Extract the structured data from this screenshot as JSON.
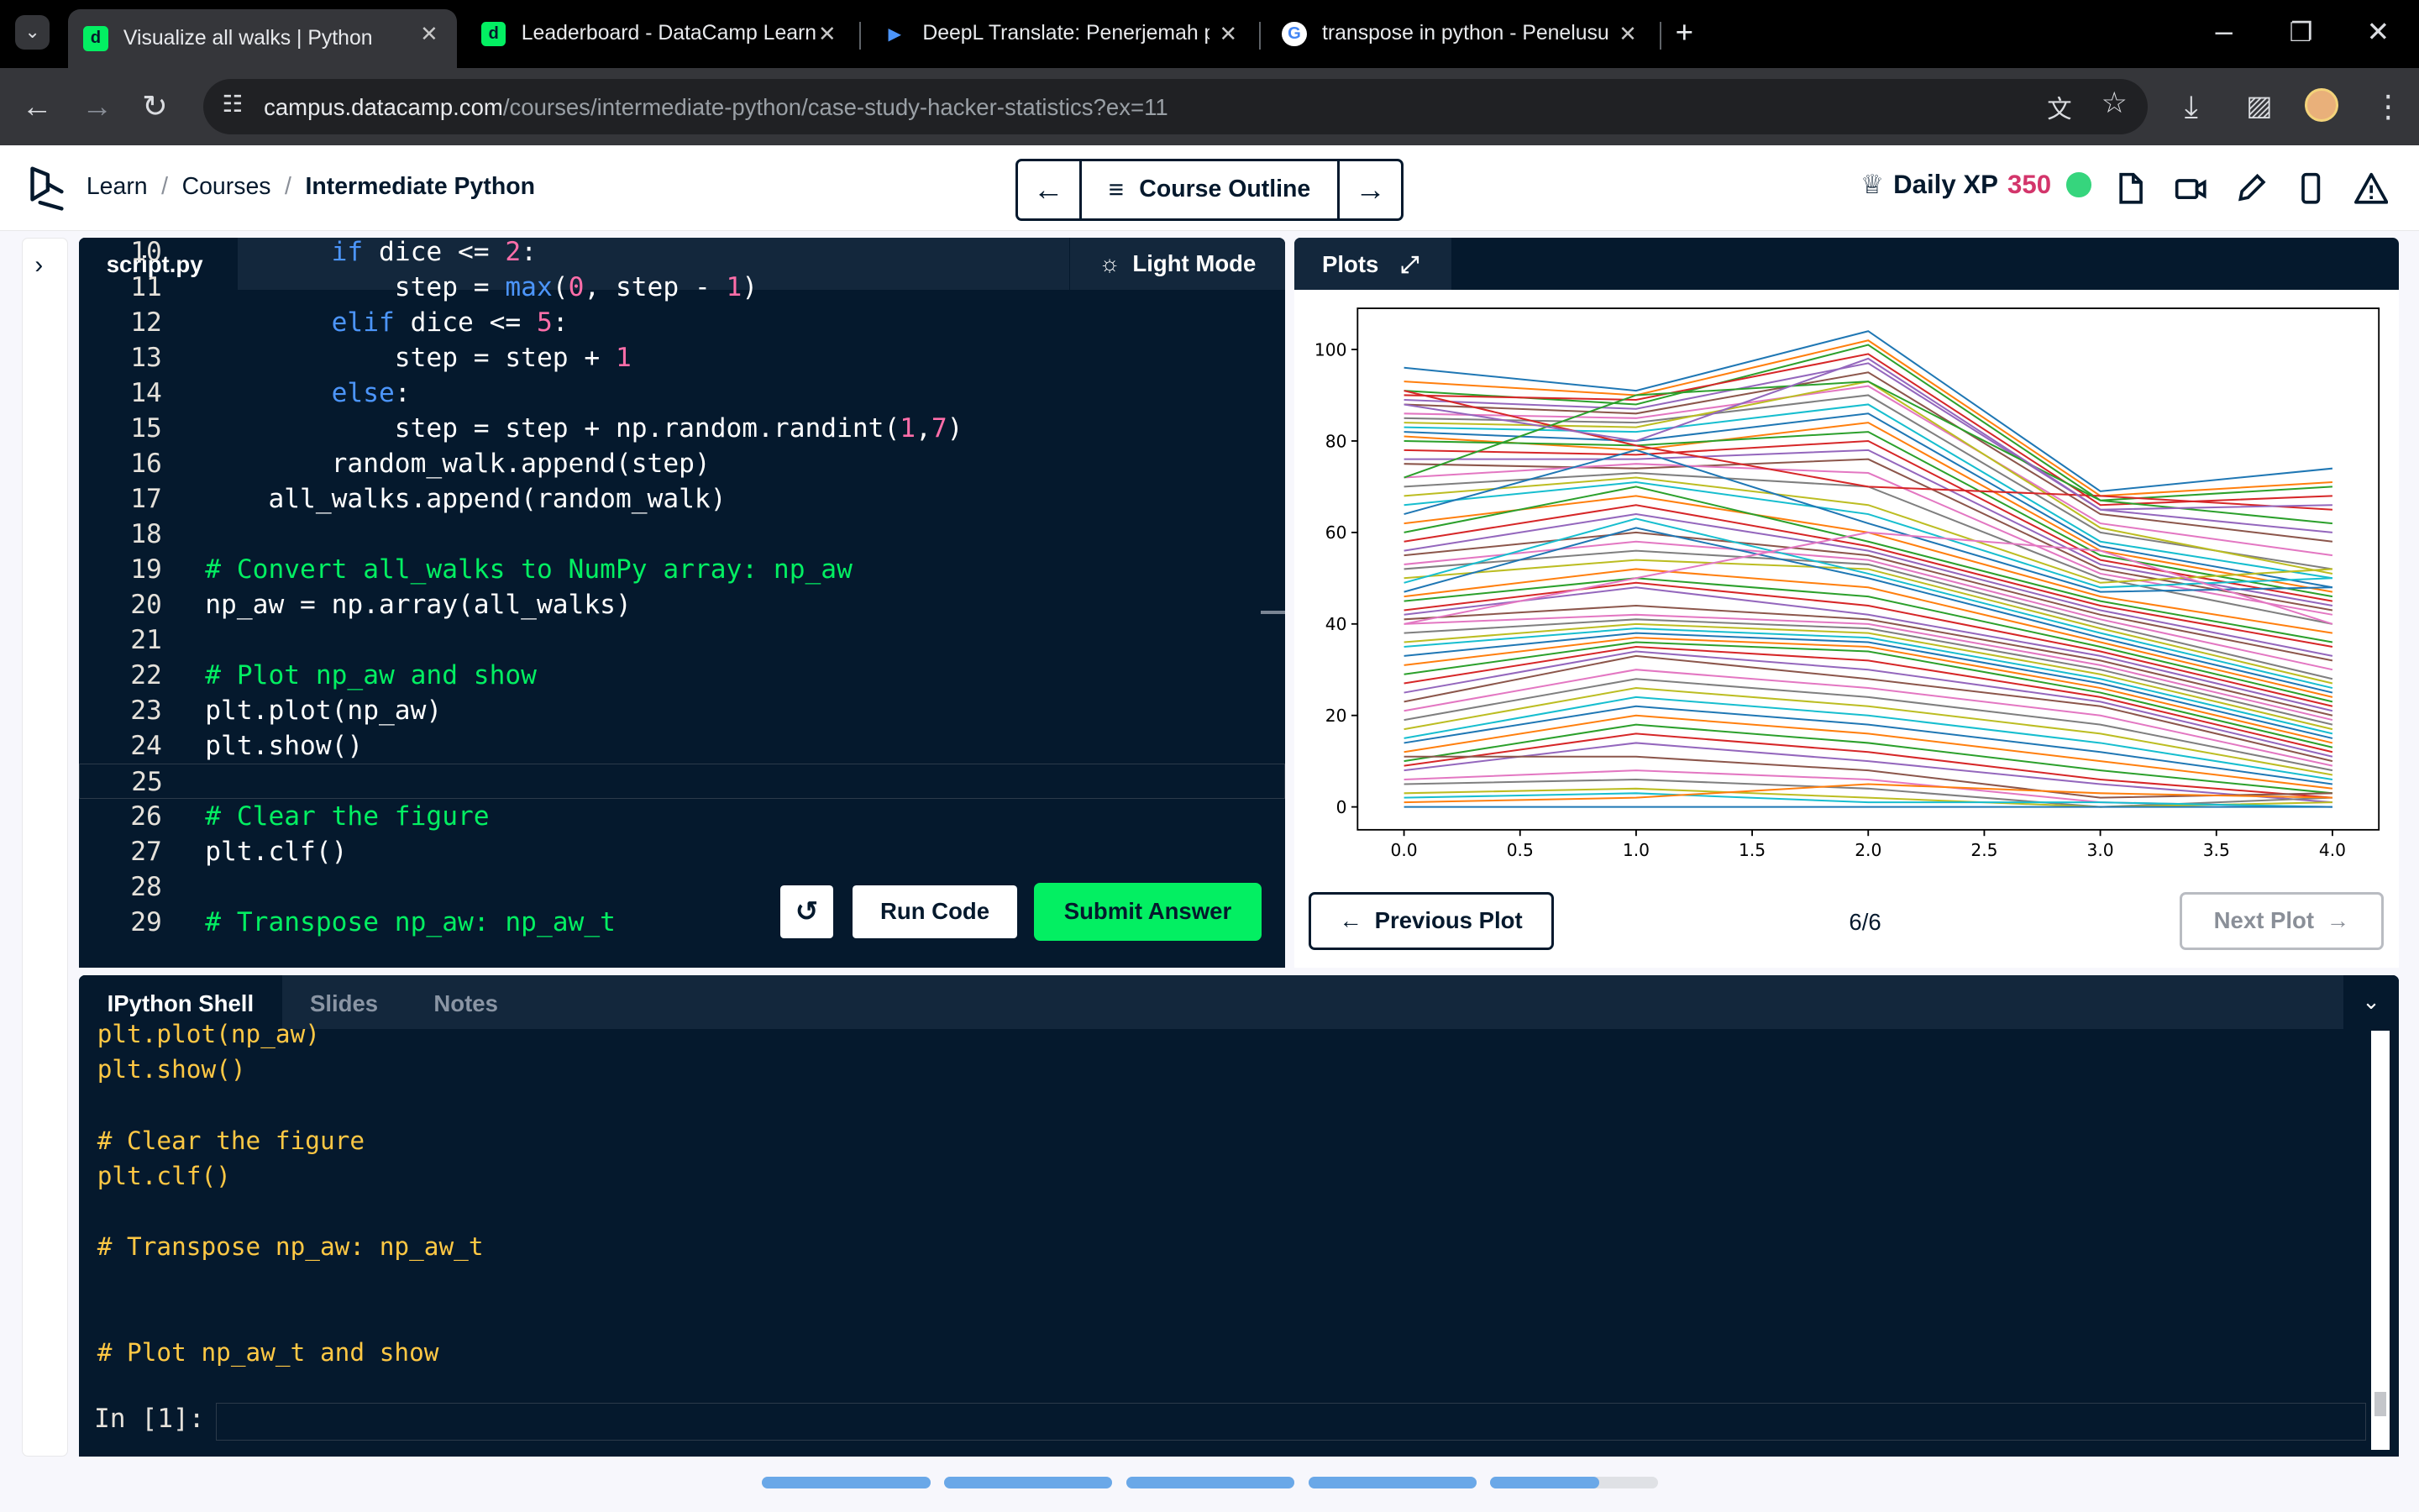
{
  "browser": {
    "tabs": [
      {
        "title": "Visualize all walks | Python",
        "active": true
      },
      {
        "title": "Leaderboard - DataCamp Learn",
        "active": false
      },
      {
        "title": "DeepL Translate: Penerjemah pa",
        "active": false
      },
      {
        "title": "transpose in python - Penelusur",
        "active": false
      }
    ],
    "url_host": "campus.datacamp.com",
    "url_path": "/courses/intermediate-python/case-study-hacker-statistics?ex=11"
  },
  "header": {
    "breadcrumb": [
      "Learn",
      "Courses",
      "Intermediate Python"
    ],
    "course_outline": "Course Outline",
    "daily_xp_label": "Daily XP",
    "daily_xp_value": "350"
  },
  "editor": {
    "file_tab": "script.py",
    "light_mode": "Light Mode",
    "lines": [
      {
        "n": "10",
        "code": "        if dice <= 2:"
      },
      {
        "n": "11",
        "code": "            step = max(0, step - 1)"
      },
      {
        "n": "12",
        "code": "        elif dice <= 5:"
      },
      {
        "n": "13",
        "code": "            step = step + 1"
      },
      {
        "n": "14",
        "code": "        else:"
      },
      {
        "n": "15",
        "code": "            step = step + np.random.randint(1,7)"
      },
      {
        "n": "16",
        "code": "        random_walk.append(step)"
      },
      {
        "n": "17",
        "code": "    all_walks.append(random_walk)"
      },
      {
        "n": "18",
        "code": ""
      },
      {
        "n": "19",
        "code": "# Convert all_walks to NumPy array: np_aw"
      },
      {
        "n": "20",
        "code": "np_aw = np.array(all_walks)"
      },
      {
        "n": "21",
        "code": ""
      },
      {
        "n": "22",
        "code": "# Plot np_aw and show"
      },
      {
        "n": "23",
        "code": "plt.plot(np_aw)"
      },
      {
        "n": "24",
        "code": "plt.show()"
      },
      {
        "n": "25",
        "code": ""
      },
      {
        "n": "26",
        "code": "# Clear the figure"
      },
      {
        "n": "27",
        "code": "plt.clf()"
      },
      {
        "n": "28",
        "code": ""
      },
      {
        "n": "29",
        "code": "# Transpose np_aw: np_aw_t"
      }
    ],
    "run_label": "Run Code",
    "submit_label": "Submit Answer"
  },
  "plots": {
    "tab_label": "Plots",
    "prev_label": "Previous Plot",
    "next_label": "Next Plot",
    "page": "6/6"
  },
  "chart_data": {
    "type": "line",
    "xticks": [
      "0.0",
      "0.5",
      "1.0",
      "1.5",
      "2.0",
      "2.5",
      "3.0",
      "3.5",
      "4.0"
    ],
    "yticks": [
      "0",
      "20",
      "40",
      "60",
      "80",
      "100"
    ],
    "xlim": [
      -0.2,
      4.2
    ],
    "ylim": [
      -5,
      109
    ],
    "x": [
      0,
      1,
      2,
      3,
      4
    ],
    "series": [
      {
        "color": "#1f77b4",
        "values": [
          96,
          91,
          104,
          69,
          74
        ]
      },
      {
        "color": "#ff7f0e",
        "values": [
          93,
          90,
          102,
          68,
          71
        ]
      },
      {
        "color": "#2ca02c",
        "values": [
          91,
          88,
          101,
          67,
          70
        ]
      },
      {
        "color": "#d62728",
        "values": [
          90,
          89,
          99,
          66,
          68
        ]
      },
      {
        "color": "#9467bd",
        "values": [
          89,
          87,
          97,
          65,
          60
        ]
      },
      {
        "color": "#8c564b",
        "values": [
          88,
          86,
          95,
          64,
          58
        ]
      },
      {
        "color": "#e377c2",
        "values": [
          86,
          85,
          92,
          62,
          55
        ]
      },
      {
        "color": "#7f7f7f",
        "values": [
          85,
          84,
          90,
          60,
          52
        ]
      },
      {
        "color": "#bcbd22",
        "values": [
          84,
          83,
          93,
          61,
          51
        ]
      },
      {
        "color": "#17becf",
        "values": [
          83,
          82,
          88,
          58,
          50
        ]
      },
      {
        "color": "#1f77b4",
        "values": [
          82,
          80,
          86,
          57,
          48
        ]
      },
      {
        "color": "#ff7f0e",
        "values": [
          81,
          78,
          84,
          56,
          47
        ]
      },
      {
        "color": "#2ca02c",
        "values": [
          80,
          79,
          82,
          55,
          46
        ]
      },
      {
        "color": "#d62728",
        "values": [
          78,
          77,
          80,
          54,
          45
        ]
      },
      {
        "color": "#9467bd",
        "values": [
          76,
          76,
          78,
          53,
          44
        ]
      },
      {
        "color": "#8c564b",
        "values": [
          75,
          74,
          76,
          52,
          43
        ]
      },
      {
        "color": "#e377c2",
        "values": [
          72,
          75,
          73,
          51,
          42
        ]
      },
      {
        "color": "#7f7f7f",
        "values": [
          70,
          73,
          70,
          50,
          40
        ]
      },
      {
        "color": "#bcbd22",
        "values": [
          68,
          72,
          66,
          49,
          52
        ]
      },
      {
        "color": "#17becf",
        "values": [
          66,
          71,
          64,
          48,
          50
        ]
      },
      {
        "color": "#1f77b4",
        "values": [
          64,
          78,
          62,
          47,
          48
        ]
      },
      {
        "color": "#ff7f0e",
        "values": [
          62,
          68,
          60,
          46,
          38
        ]
      },
      {
        "color": "#2ca02c",
        "values": [
          60,
          70,
          58,
          45,
          36
        ]
      },
      {
        "color": "#d62728",
        "values": [
          58,
          66,
          57,
          44,
          35
        ]
      },
      {
        "color": "#9467bd",
        "values": [
          56,
          64,
          56,
          43,
          33
        ]
      },
      {
        "color": "#8c564b",
        "values": [
          55,
          60,
          55,
          42,
          32
        ]
      },
      {
        "color": "#e377c2",
        "values": [
          53,
          58,
          54,
          41,
          30
        ]
      },
      {
        "color": "#7f7f7f",
        "values": [
          52,
          56,
          53,
          40,
          28
        ]
      },
      {
        "color": "#bcbd22",
        "values": [
          50,
          54,
          52,
          39,
          27
        ]
      },
      {
        "color": "#17becf",
        "values": [
          49,
          63,
          51,
          38,
          26
        ]
      },
      {
        "color": "#1f77b4",
        "values": [
          47,
          61,
          50,
          37,
          25
        ]
      },
      {
        "color": "#ff7f0e",
        "values": [
          46,
          52,
          48,
          36,
          24
        ]
      },
      {
        "color": "#2ca02c",
        "values": [
          45,
          50,
          46,
          35,
          23
        ]
      },
      {
        "color": "#d62728",
        "values": [
          43,
          49,
          44,
          34,
          22
        ]
      },
      {
        "color": "#9467bd",
        "values": [
          42,
          48,
          42,
          33,
          21
        ]
      },
      {
        "color": "#8c564b",
        "values": [
          41,
          44,
          41,
          32,
          20
        ]
      },
      {
        "color": "#e377c2",
        "values": [
          40,
          42,
          40,
          31,
          19
        ]
      },
      {
        "color": "#7f7f7f",
        "values": [
          38,
          41,
          39,
          30,
          18
        ]
      },
      {
        "color": "#bcbd22",
        "values": [
          36,
          40,
          38,
          29,
          17
        ]
      },
      {
        "color": "#17becf",
        "values": [
          35,
          39,
          37,
          28,
          16
        ]
      },
      {
        "color": "#1f77b4",
        "values": [
          33,
          38,
          36,
          27,
          15
        ]
      },
      {
        "color": "#ff7f0e",
        "values": [
          31,
          37,
          35,
          26,
          14
        ]
      },
      {
        "color": "#2ca02c",
        "values": [
          29,
          36,
          34,
          25,
          13
        ]
      },
      {
        "color": "#d62728",
        "values": [
          27,
          35,
          32,
          24,
          12
        ]
      },
      {
        "color": "#9467bd",
        "values": [
          25,
          34,
          30,
          23,
          11
        ]
      },
      {
        "color": "#8c564b",
        "values": [
          23,
          33,
          28,
          22,
          10
        ]
      },
      {
        "color": "#e377c2",
        "values": [
          21,
          30,
          26,
          20,
          9
        ]
      },
      {
        "color": "#7f7f7f",
        "values": [
          19,
          28,
          24,
          18,
          8
        ]
      },
      {
        "color": "#bcbd22",
        "values": [
          17,
          26,
          22,
          16,
          7
        ]
      },
      {
        "color": "#17becf",
        "values": [
          15,
          24,
          20,
          14,
          6
        ]
      },
      {
        "color": "#1f77b4",
        "values": [
          14,
          22,
          18,
          12,
          5
        ]
      },
      {
        "color": "#ff7f0e",
        "values": [
          12,
          20,
          16,
          10,
          4
        ]
      },
      {
        "color": "#2ca02c",
        "values": [
          10,
          18,
          14,
          8,
          3
        ]
      },
      {
        "color": "#d62728",
        "values": [
          9,
          16,
          12,
          6,
          2
        ]
      },
      {
        "color": "#9467bd",
        "values": [
          8,
          14,
          10,
          5,
          1
        ]
      },
      {
        "color": "#8c564b",
        "values": [
          11,
          11,
          8,
          2,
          3
        ]
      },
      {
        "color": "#e377c2",
        "values": [
          6,
          8,
          6,
          1,
          0
        ]
      },
      {
        "color": "#7f7f7f",
        "values": [
          5,
          6,
          4,
          0,
          2
        ]
      },
      {
        "color": "#bcbd22",
        "values": [
          3,
          4,
          2,
          0,
          1
        ]
      },
      {
        "color": "#17becf",
        "values": [
          2,
          3,
          1,
          1,
          0
        ]
      },
      {
        "color": "#1f77b4",
        "values": [
          0,
          0,
          0,
          0,
          0
        ]
      },
      {
        "color": "#ff7f0e",
        "values": [
          1,
          2,
          5,
          3,
          2
        ]
      },
      {
        "color": "#d62728",
        "values": [
          91,
          79,
          70,
          68,
          65
        ]
      },
      {
        "color": "#2ca02c",
        "values": [
          72,
          90,
          93,
          67,
          62
        ]
      },
      {
        "color": "#9467bd",
        "values": [
          88,
          80,
          98,
          65,
          66
        ]
      },
      {
        "color": "#e377c2",
        "values": [
          40,
          50,
          60,
          56,
          40
        ]
      }
    ]
  },
  "shell": {
    "tabs": [
      "IPython Shell",
      "Slides",
      "Notes"
    ],
    "lines": [
      "plt.plot(np_aw)",
      "plt.show()",
      "",
      "# Clear the figure",
      "plt.clf()",
      "",
      "# Transpose np_aw: np_aw_t",
      "",
      "",
      "# Plot np_aw_t and show"
    ],
    "prompt": "In [1]:"
  },
  "progress": {
    "segments_total": 5,
    "fraction": 0.93
  }
}
